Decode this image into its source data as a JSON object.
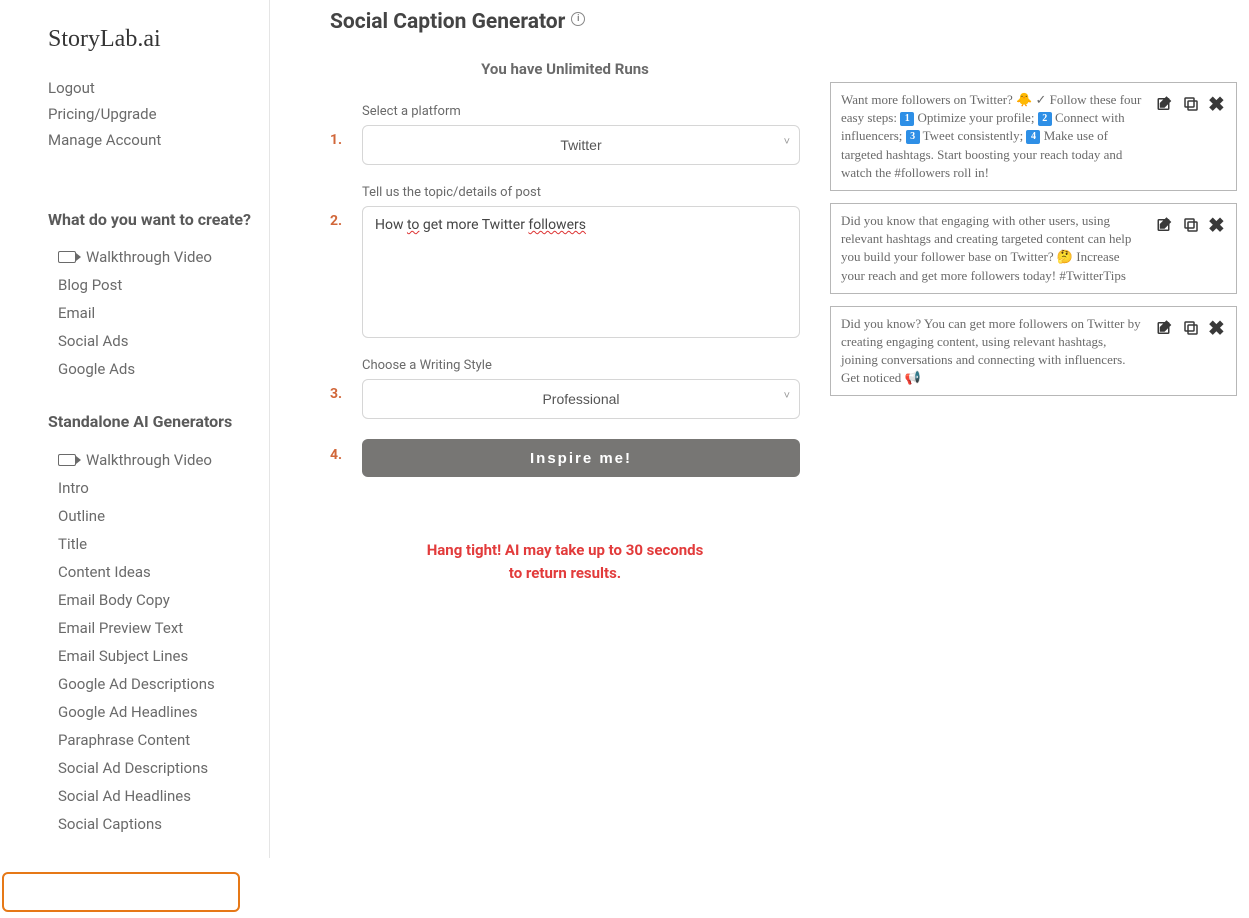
{
  "brand": "StoryLab.ai",
  "account": {
    "logout": "Logout",
    "pricing": "Pricing/Upgrade",
    "manage": "Manage Account"
  },
  "sidebar": {
    "create_header": "What do you want to create?",
    "create_items": [
      {
        "label": "Walkthrough Video",
        "icon": true
      },
      {
        "label": "Blog Post"
      },
      {
        "label": "Email"
      },
      {
        "label": "Social Ads"
      },
      {
        "label": "Google Ads"
      }
    ],
    "standalone_header": "Standalone AI Generators",
    "standalone_items": [
      {
        "label": "Walkthrough Video",
        "icon": true
      },
      {
        "label": "Intro"
      },
      {
        "label": "Outline"
      },
      {
        "label": "Title"
      },
      {
        "label": "Content Ideas"
      },
      {
        "label": "Email Body Copy"
      },
      {
        "label": "Email Preview Text"
      },
      {
        "label": "Email Subject Lines"
      },
      {
        "label": "Google Ad Descriptions"
      },
      {
        "label": "Google Ad Headlines"
      },
      {
        "label": "Paraphrase Content"
      },
      {
        "label": "Social Ad Descriptions"
      },
      {
        "label": "Social Ad Headlines"
      },
      {
        "label": "Social Captions"
      }
    ],
    "highlighted_index": 13
  },
  "page": {
    "title": "Social Caption Generator",
    "runs": "You have Unlimited Runs"
  },
  "form": {
    "step1_label": "Select a platform",
    "step1_value": "Twitter",
    "step2_label": "Tell us the topic/details of post",
    "step2_value_pre": "How ",
    "step2_value_u1": "to",
    "step2_value_mid": " get more Twitter ",
    "step2_value_u2": "followers",
    "step3_label": "Choose a Writing Style",
    "step3_value": "Professional",
    "submit": "Inspire me!",
    "nums": {
      "one": "1.",
      "two": "2.",
      "three": "3.",
      "four": "4."
    }
  },
  "loading": {
    "line1": "Hang tight! AI may take up to 30 seconds",
    "line2": "to return results."
  },
  "results": [
    {
      "parts": [
        {
          "t": "Want more followers on Twitter? 🐥 ✓ Follow these four easy steps: "
        },
        {
          "num": "1"
        },
        {
          "t": " Optimize your profile; "
        },
        {
          "num": "2"
        },
        {
          "t": " Connect with influencers; "
        },
        {
          "num": "3"
        },
        {
          "t": " Tweet consistently; "
        },
        {
          "num": "4"
        },
        {
          "t": " Make use of targeted hashtags. Start boosting your reach today and watch the #followers roll in!"
        }
      ]
    },
    {
      "parts": [
        {
          "t": "Did you know that engaging with other users, using relevant hashtags and creating targeted content can help you build your follower base on Twitter? 🤔 Increase your reach and get more followers today! #TwitterTips"
        }
      ]
    },
    {
      "parts": [
        {
          "t": "Did you know? You can get more followers on Twitter by creating engaging content, using relevant hashtags, joining conversations and connecting with influencers. Get noticed 📢"
        }
      ]
    }
  ]
}
